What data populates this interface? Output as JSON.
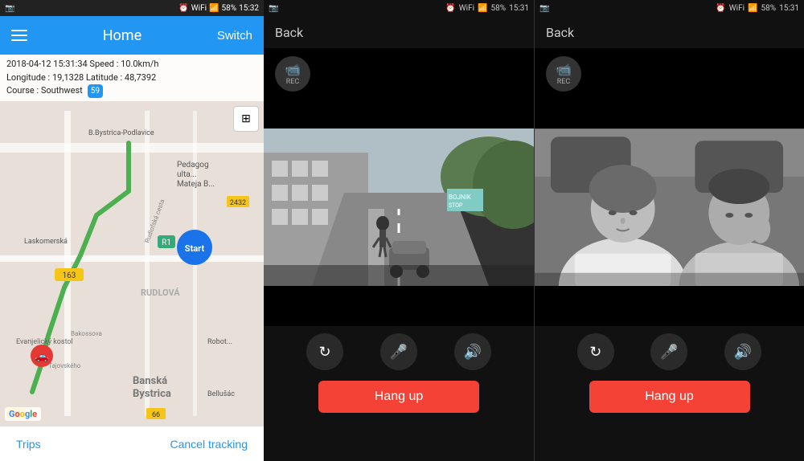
{
  "panel_map": {
    "status_bar": {
      "time": "15:32",
      "battery": "58%",
      "signal": "4G"
    },
    "app_bar": {
      "title": "Home",
      "switch_label": "Switch"
    },
    "info": {
      "line1": "2018-04-12  15:31:34   Speed : 10.0km/h",
      "line2": "Longitude : 19,1328   Latitude : 48,7392",
      "line3": "Course : Southwest"
    },
    "badge": "59",
    "bottom": {
      "trips_label": "Trips",
      "cancel_label": "Cancel tracking"
    }
  },
  "panel_video1": {
    "status_bar": {
      "time": "15:31",
      "battery": "58%"
    },
    "back_label": "Back",
    "rec_label": "REC",
    "hang_up_label": "Hang up",
    "controls": {
      "rotate": "↻",
      "mute_video": "🚫",
      "speaker": "🔊"
    }
  },
  "panel_video2": {
    "status_bar": {
      "time": "15:31",
      "battery": "58%"
    },
    "back_label": "Back",
    "rec_label": "REC",
    "hang_up_label": "Hang up",
    "controls": {
      "rotate": "↻",
      "mute_video": "🚫",
      "speaker": "🔊"
    }
  }
}
